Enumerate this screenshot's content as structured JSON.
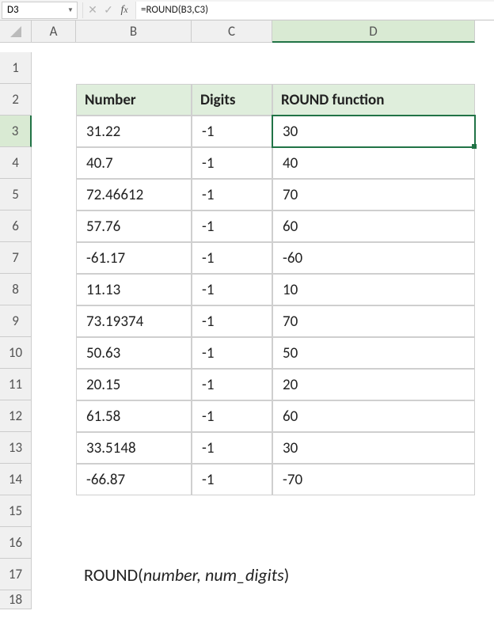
{
  "nameBox": "D3",
  "formula": "=ROUND(B3,C3)",
  "columns": [
    "A",
    "B",
    "C",
    "D"
  ],
  "rows": [
    "1",
    "2",
    "3",
    "4",
    "5",
    "6",
    "7",
    "8",
    "9",
    "10",
    "11",
    "12",
    "13",
    "14",
    "15",
    "16",
    "17",
    "18"
  ],
  "headers": {
    "b": "Number",
    "c": "Digits",
    "d": "ROUND function"
  },
  "data": [
    {
      "b": "31.22",
      "c": "-1",
      "d": "30"
    },
    {
      "b": "40.7",
      "c": "-1",
      "d": "40"
    },
    {
      "b": "72.46612",
      "c": "-1",
      "d": "70"
    },
    {
      "b": "57.76",
      "c": "-1",
      "d": "60"
    },
    {
      "b": "-61.17",
      "c": "-1",
      "d": "-60"
    },
    {
      "b": "11.13",
      "c": "-1",
      "d": "10"
    },
    {
      "b": "73.19374",
      "c": "-1",
      "d": "70"
    },
    {
      "b": "50.63",
      "c": "-1",
      "d": "50"
    },
    {
      "b": "20.15",
      "c": "-1",
      "d": "20"
    },
    {
      "b": "61.58",
      "c": "-1",
      "d": "60"
    },
    {
      "b": "33.5148",
      "c": "-1",
      "d": "30"
    },
    {
      "b": "-66.87",
      "c": "-1",
      "d": "-70"
    }
  ],
  "syntax": {
    "fn": "ROUND(",
    "arg1": "number, ",
    "arg2": "num_digits",
    "close": ")"
  },
  "selectedCell": "D3",
  "selectedRow": 3,
  "selectedCol": "D"
}
